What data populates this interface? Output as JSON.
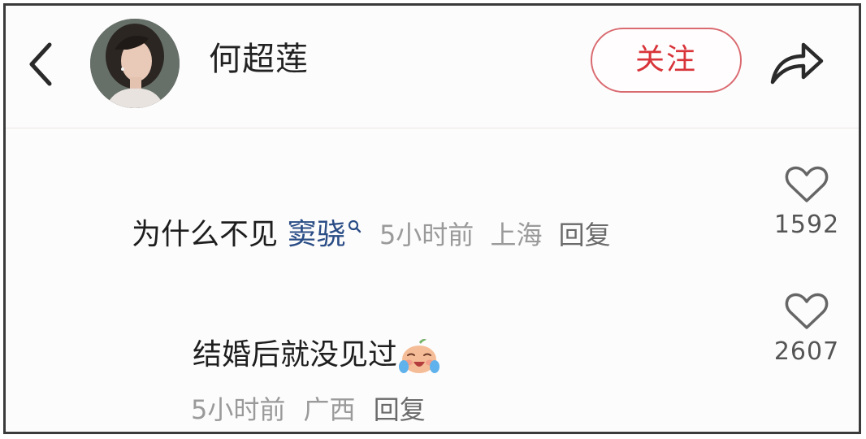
{
  "header": {
    "username": "何超莲",
    "follow_label": "关注",
    "icons": {
      "back": "chevron-left-icon",
      "share": "share-arrow-icon",
      "avatar": "user-avatar"
    }
  },
  "colors": {
    "accent": "#d8343a",
    "follow_border": "#d96a70",
    "topic_link": "#2a4d86",
    "meta_text": "#9a9a9a"
  },
  "comments": [
    {
      "text": "为什么不见",
      "topic": "窦骁",
      "time": "5小时前",
      "location": "上海",
      "reply_label": "回复",
      "likes": "1592"
    },
    {
      "text": "结婚后就没见过",
      "emoji": "crying-face-emoji",
      "time": "5小时前",
      "location": "广西",
      "reply_label": "回复",
      "likes": "2607"
    }
  ]
}
